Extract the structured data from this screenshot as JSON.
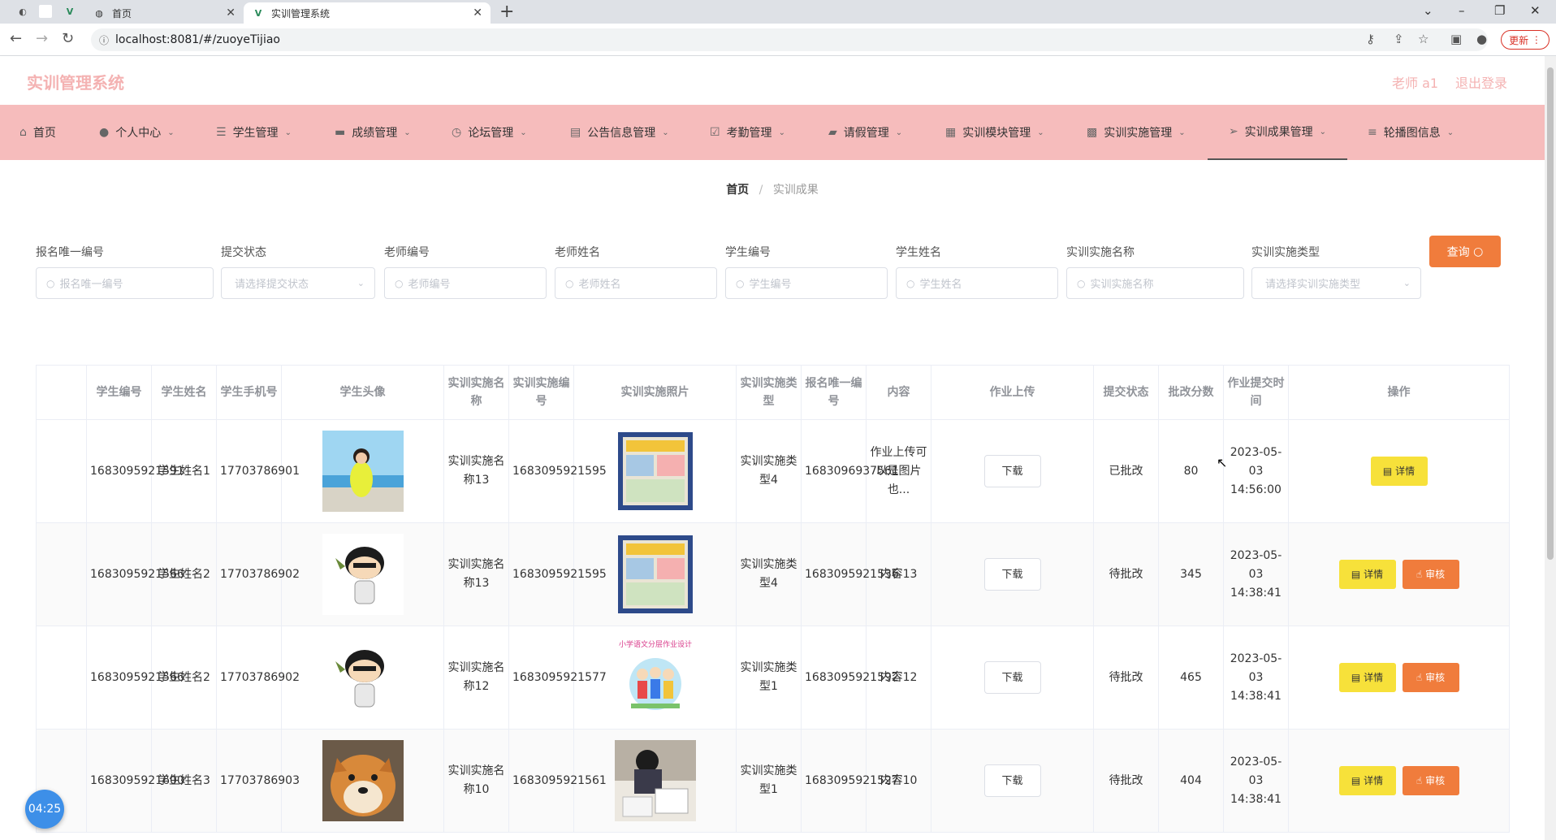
{
  "browser": {
    "tabs": [
      {
        "title": "首页"
      },
      {
        "title": "实训管理系统"
      }
    ],
    "url": "localhost:8081/#/zuoyeTijiao",
    "update_label": "更新"
  },
  "app": {
    "title": "实训管理系统",
    "user": "老师 a1",
    "logout": "退出登录"
  },
  "menu": [
    {
      "label": "首页",
      "icon": "home-icon"
    },
    {
      "label": "个人中心",
      "icon": "user-icon"
    },
    {
      "label": "学生管理",
      "icon": "list-icon"
    },
    {
      "label": "成绩管理",
      "icon": "monitor-icon"
    },
    {
      "label": "论坛管理",
      "icon": "clock-icon"
    },
    {
      "label": "公告信息管理",
      "icon": "document-icon"
    },
    {
      "label": "考勤管理",
      "icon": "check-icon"
    },
    {
      "label": "请假管理",
      "icon": "folder-icon"
    },
    {
      "label": "实训模块管理",
      "icon": "grid-icon"
    },
    {
      "label": "实训实施管理",
      "icon": "box-icon"
    },
    {
      "label": "实训成果管理",
      "icon": "send-icon"
    },
    {
      "label": "轮播图信息",
      "icon": "menu-icon"
    }
  ],
  "breadcrumb": {
    "home": "首页",
    "current": "实训成果"
  },
  "search": {
    "fields": [
      {
        "label": "报名唯一编号",
        "placeholder": "报名唯一编号",
        "type": "input"
      },
      {
        "label": "提交状态",
        "placeholder": "请选择提交状态",
        "type": "select"
      },
      {
        "label": "老师编号",
        "placeholder": "老师编号",
        "type": "input"
      },
      {
        "label": "老师姓名",
        "placeholder": "老师姓名",
        "type": "input"
      },
      {
        "label": "学生编号",
        "placeholder": "学生编号",
        "type": "input"
      },
      {
        "label": "学生姓名",
        "placeholder": "学生姓名",
        "type": "input"
      },
      {
        "label": "实训实施名称",
        "placeholder": "实训实施名称",
        "type": "input"
      },
      {
        "label": "实训实施类型",
        "placeholder": "请选择实训实施类型",
        "type": "select"
      }
    ],
    "query_label": "查询"
  },
  "table": {
    "headers": [
      "学生编号",
      "学生姓名",
      "学生手机号",
      "学生头像",
      "实训实施名称",
      "实训实施编号",
      "实训实施照片",
      "实训实施类型",
      "报名唯一编号",
      "内容",
      "作业上传",
      "提交状态",
      "批改分数",
      "作业提交时间",
      "操作"
    ],
    "download_label": "下载",
    "detail_label": "详情",
    "review_label": "审核",
    "rows": [
      {
        "student_no": "1683095921591",
        "student_name": "学生姓名1",
        "phone": "17703786901",
        "avatar": "girl-photo",
        "impl_name": "实训实施名称13",
        "impl_no": "1683095921595",
        "photo": "poster-photo",
        "impl_type": "实训实施类型4",
        "reg_no": "1683096937561",
        "content": "作业上传可以是图片也...",
        "status": "已批改",
        "score": "80",
        "time": "2023-05-03 14:56:00",
        "review": false
      },
      {
        "student_no": "1683095921566",
        "student_name": "学生姓名2",
        "phone": "17703786902",
        "avatar": "cartoon-boy",
        "impl_name": "实训实施名称13",
        "impl_no": "1683095921595",
        "photo": "poster-photo",
        "impl_type": "实训实施类型4",
        "reg_no": "1683095921536",
        "content": "内容13",
        "status": "待批改",
        "score": "345",
        "time": "2023-05-03 14:38:41",
        "review": true
      },
      {
        "student_no": "1683095921566",
        "student_name": "学生姓名2",
        "phone": "17703786902",
        "avatar": "cartoon-boy",
        "impl_name": "实训实施名称12",
        "impl_no": "1683095921577",
        "photo": "kids-poster",
        "impl_type": "实训实施类型1",
        "reg_no": "1683095921592",
        "content": "内容12",
        "status": "待批改",
        "score": "465",
        "time": "2023-05-03 14:38:41",
        "review": true
      },
      {
        "student_no": "1683095921600",
        "student_name": "学生姓名3",
        "phone": "17703786903",
        "avatar": "dog-photo",
        "impl_name": "实训实施名称10",
        "impl_no": "1683095921561",
        "photo": "student-photo",
        "impl_type": "实训实施类型1",
        "reg_no": "1683095921527",
        "content": "内容10",
        "status": "待批改",
        "score": "404",
        "time": "2023-05-03 14:38:41",
        "review": true
      }
    ],
    "poster_text": "小学语文分层作业设计"
  },
  "timer": "04:25"
}
